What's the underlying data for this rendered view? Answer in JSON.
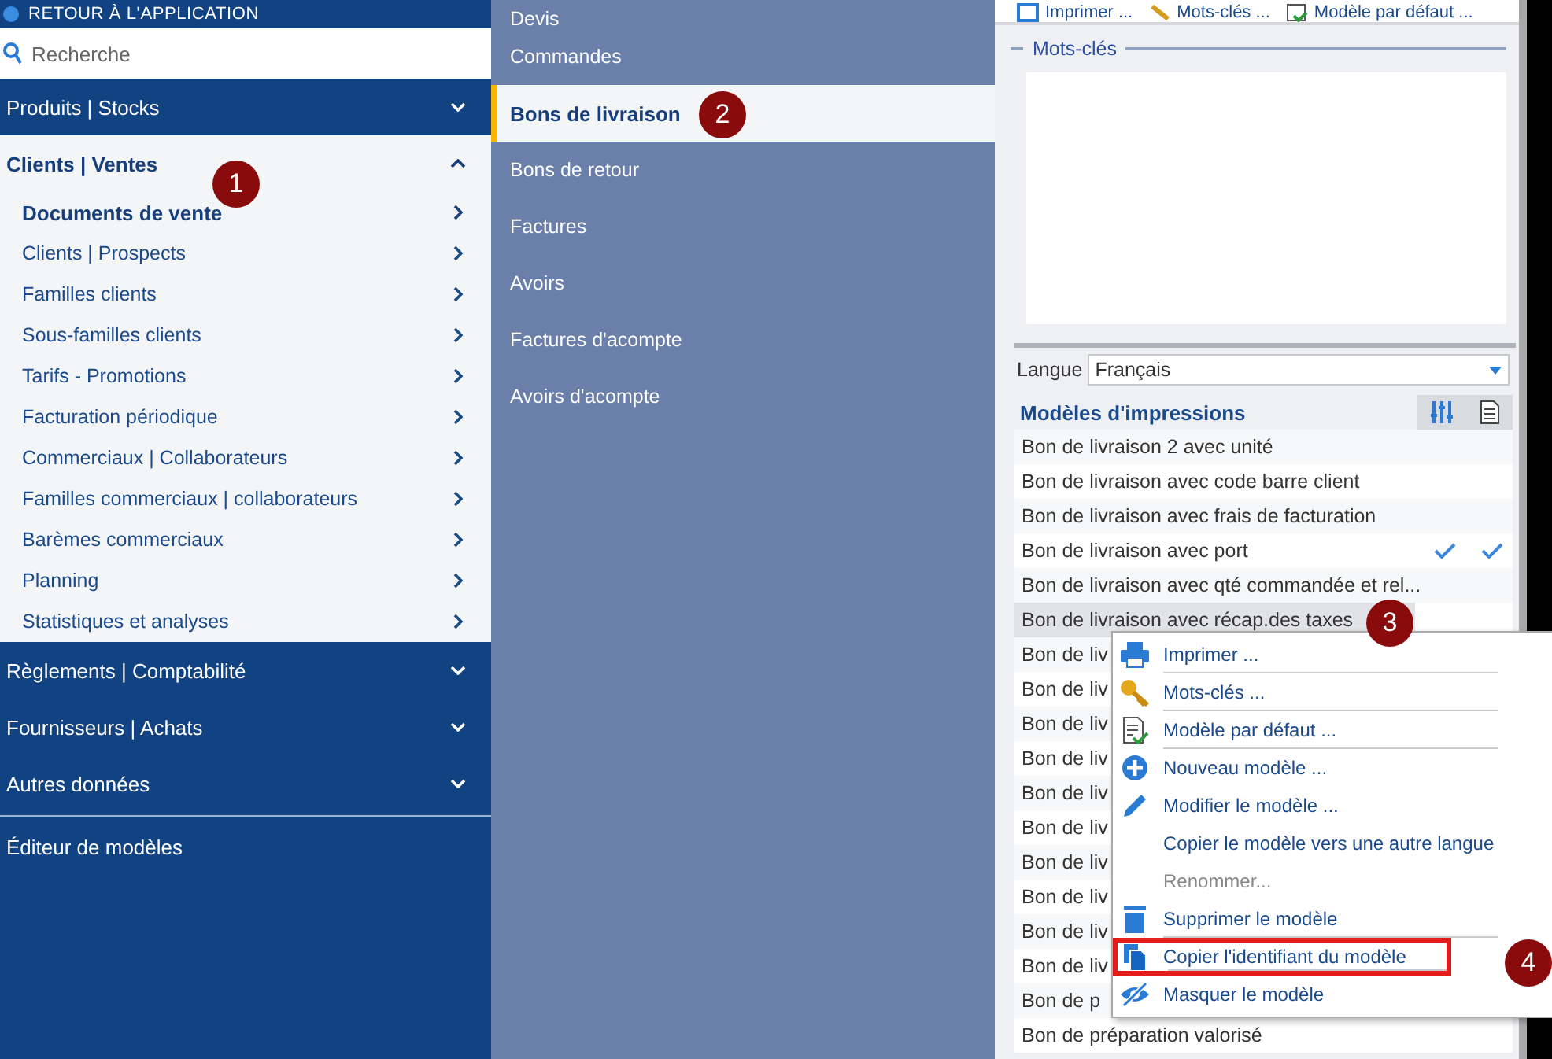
{
  "sidebar": {
    "back_link": "RETOUR À L'APPLICATION",
    "search": {
      "placeholder": "Recherche"
    },
    "sections": [
      {
        "label": "Produits | Stocks",
        "expanded": false
      },
      {
        "label": "Clients | Ventes",
        "expanded": true,
        "children": [
          {
            "label": "Documents de vente",
            "selected": true
          },
          {
            "label": "Clients | Prospects",
            "selected": false
          },
          {
            "label": "Familles clients",
            "selected": false
          },
          {
            "label": "Sous-familles clients",
            "selected": false
          },
          {
            "label": "Tarifs - Promotions",
            "selected": false
          },
          {
            "label": "Facturation périodique",
            "selected": false
          },
          {
            "label": "Commerciaux | Collaborateurs",
            "selected": false
          },
          {
            "label": "Familles commerciaux | collaborateurs",
            "selected": false
          },
          {
            "label": "Barèmes commerciaux",
            "selected": false
          },
          {
            "label": "Planning",
            "selected": false
          },
          {
            "label": "Statistiques et analyses",
            "selected": false
          }
        ]
      },
      {
        "label": "Règlements | Comptabilité",
        "expanded": false
      },
      {
        "label": "Fournisseurs | Achats",
        "expanded": false
      },
      {
        "label": "Autres données",
        "expanded": false
      }
    ],
    "footer_link": "Éditeur de modèles"
  },
  "documents": [
    {
      "label": "Devis",
      "selected": false
    },
    {
      "label": "Commandes",
      "selected": false
    },
    {
      "label": "Bons de livraison",
      "selected": true
    },
    {
      "label": "Bons de retour",
      "selected": false
    },
    {
      "label": "Factures",
      "selected": false
    },
    {
      "label": "Avoirs",
      "selected": false
    },
    {
      "label": "Factures d'acompte",
      "selected": false
    },
    {
      "label": "Avoirs d'acompte",
      "selected": false
    }
  ],
  "toolbar": [
    "Imprimer ...",
    "Mots-clés ...",
    "Modèle par défaut ..."
  ],
  "keywords": {
    "title": "Mots-clés"
  },
  "language": {
    "label": "Langue",
    "value": "Français"
  },
  "models": {
    "title": "Modèles d'impressions",
    "rows": [
      {
        "name": "Bon de livraison 2 avec unité",
        "selected": false,
        "column_1_checked": false,
        "column_2_checked": false
      },
      {
        "name": "Bon de livraison avec code barre client",
        "selected": false,
        "column_1_checked": false,
        "column_2_checked": false
      },
      {
        "name": "Bon de livraison avec frais de facturation",
        "selected": false,
        "column_1_checked": false,
        "column_2_checked": false
      },
      {
        "name": "Bon de livraison avec port",
        "selected": false,
        "column_1_checked": true,
        "column_2_checked": true
      },
      {
        "name": "Bon de livraison avec qté commandée et rel...",
        "selected": false,
        "column_1_checked": false,
        "column_2_checked": false
      },
      {
        "name": "Bon de livraison avec récap.des taxes",
        "selected": true,
        "column_1_checked": false,
        "column_2_checked": false
      },
      {
        "name": "Bon de liv",
        "selected": false
      },
      {
        "name": "Bon de liv",
        "selected": false
      },
      {
        "name": "Bon de liv",
        "selected": false
      },
      {
        "name": "Bon de liv",
        "selected": false
      },
      {
        "name": "Bon de liv",
        "selected": false
      },
      {
        "name": "Bon de liv",
        "selected": false
      },
      {
        "name": "Bon de liv",
        "selected": false
      },
      {
        "name": "Bon de liv",
        "selected": false
      },
      {
        "name": "Bon de liv",
        "selected": false
      },
      {
        "name": "Bon de liv",
        "selected": false
      },
      {
        "name": "Bon de p",
        "selected": false
      },
      {
        "name": "Bon de préparation valorisé",
        "selected": false,
        "column_1_checked": false,
        "column_2_checked": false
      }
    ]
  },
  "context_menu": [
    {
      "label": "Imprimer ...",
      "disabled": false,
      "separator_after": true,
      "highlighted": false
    },
    {
      "label": "Mots-clés ...",
      "disabled": false,
      "separator_after": true,
      "highlighted": false
    },
    {
      "label": "Modèle par défaut ...",
      "disabled": false,
      "separator_after": true,
      "highlighted": false
    },
    {
      "label": "Nouveau modèle ...",
      "disabled": false,
      "separator_after": false,
      "highlighted": false
    },
    {
      "label": "Modifier le modèle ...",
      "disabled": false,
      "separator_after": false,
      "highlighted": false
    },
    {
      "label": "Copier le modèle vers une autre langue",
      "disabled": false,
      "separator_after": false,
      "highlighted": false
    },
    {
      "label": "Renommer...",
      "disabled": true,
      "separator_after": false,
      "highlighted": false
    },
    {
      "label": "Supprimer le modèle",
      "disabled": false,
      "separator_after": true,
      "highlighted": false
    },
    {
      "label": "Copier l'identifiant du modèle",
      "disabled": false,
      "separator_after": true,
      "highlighted": true
    },
    {
      "label": "Masquer le modèle",
      "disabled": false,
      "separator_after": false,
      "highlighted": false
    }
  ],
  "callouts": [
    "1",
    "2",
    "3",
    "4"
  ]
}
